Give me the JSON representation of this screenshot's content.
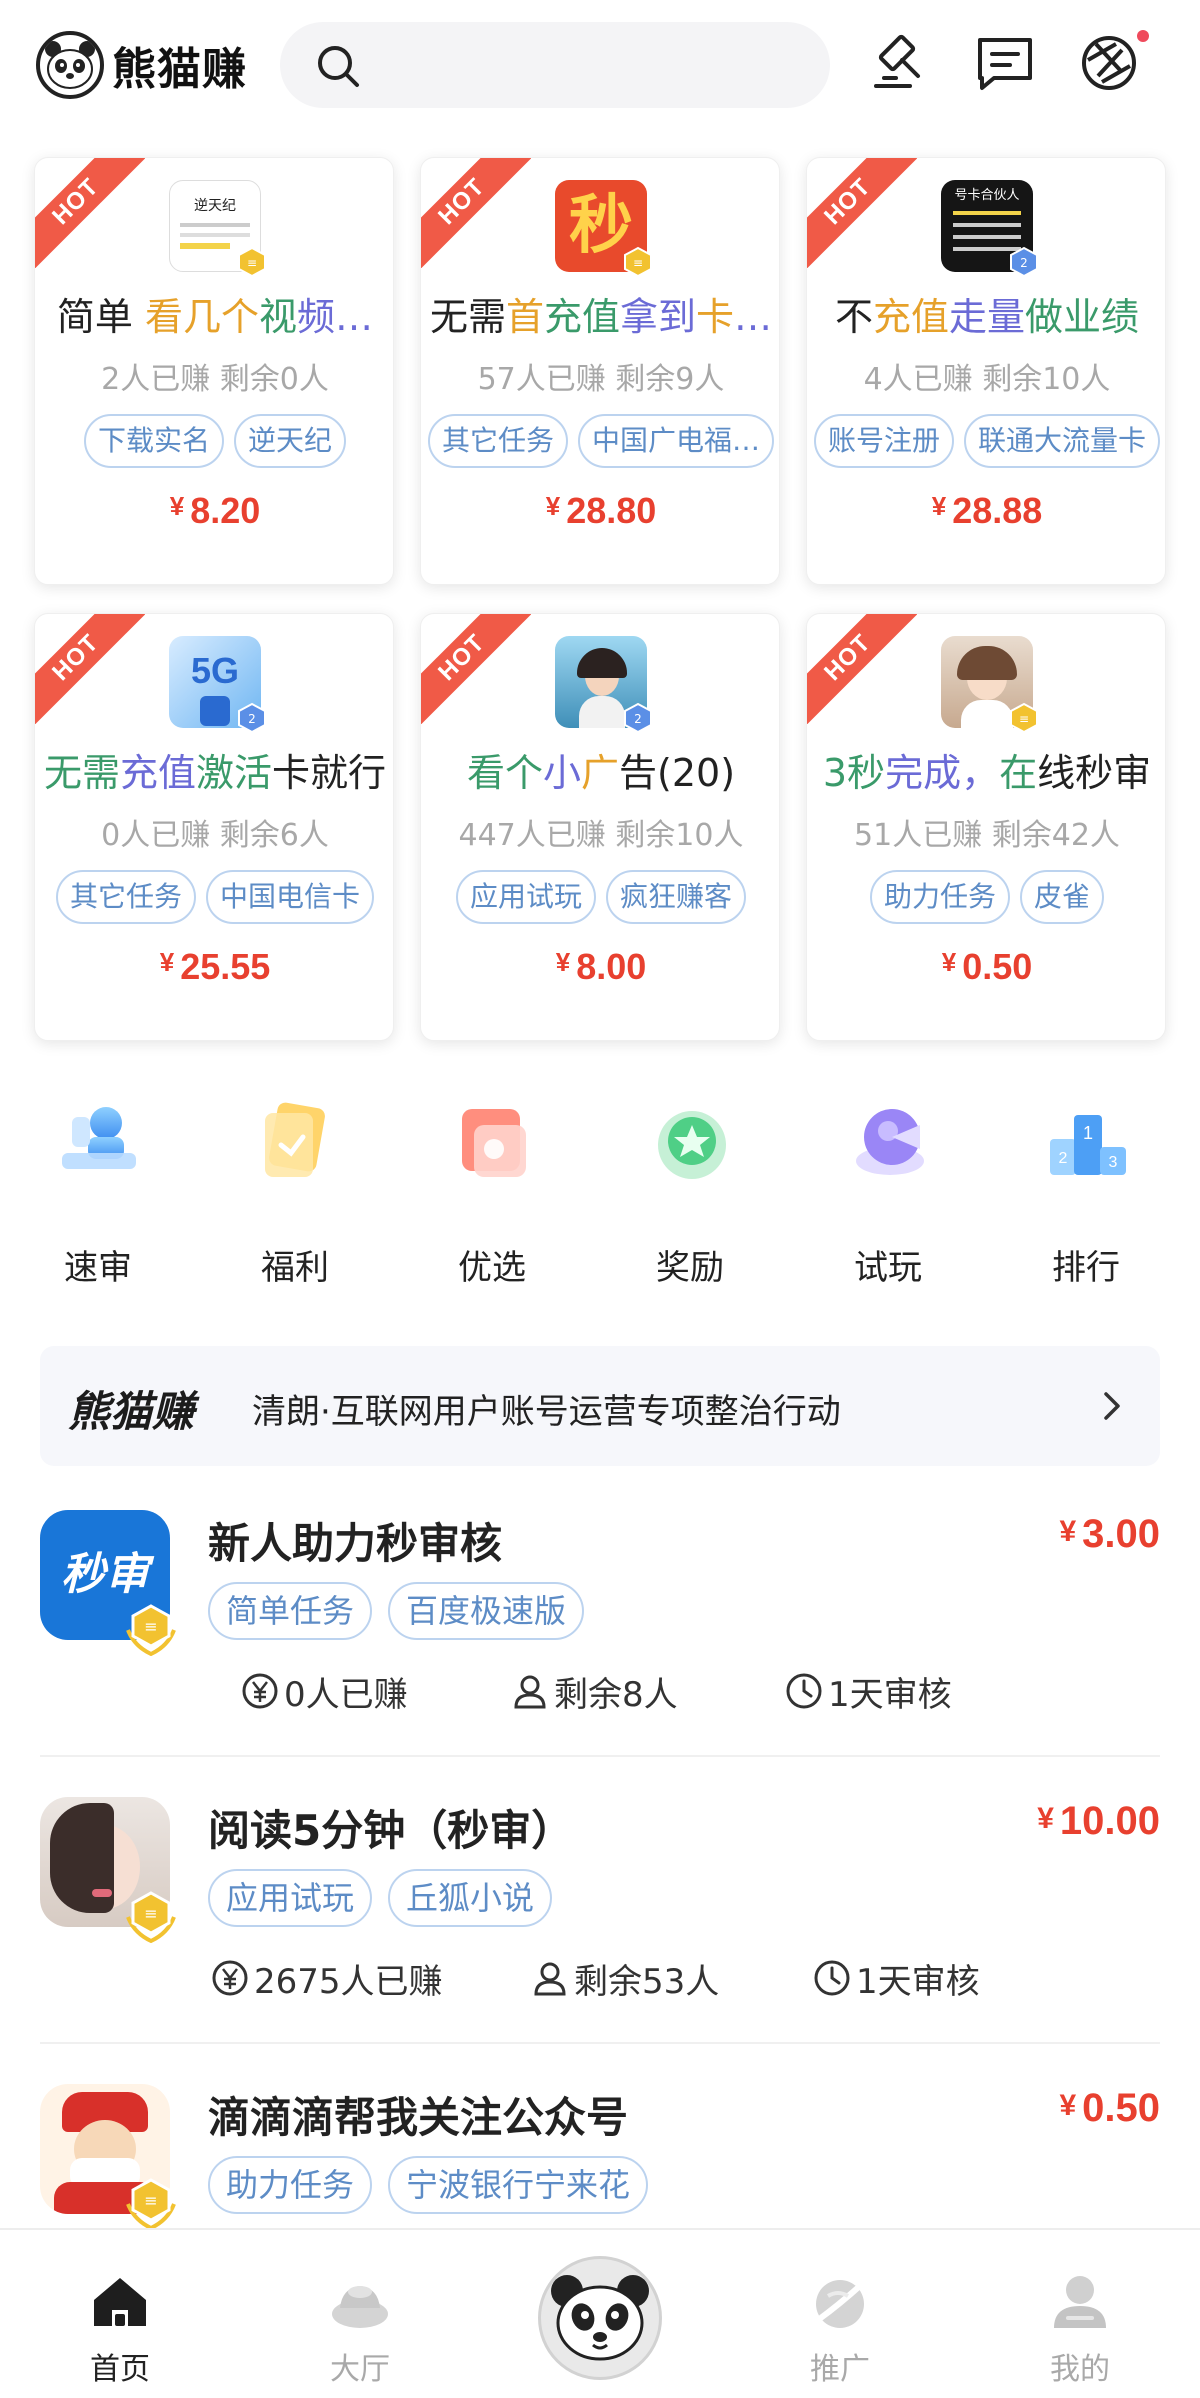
{
  "header": {
    "logo_text": "熊猫赚",
    "search_placeholder": ""
  },
  "hot_label": "HOT",
  "hot_cards": [
    {
      "title": "简单 看几个视频…",
      "stats": "2人已赚  剩余0人",
      "tags": [
        "下载实名",
        "逆天纪"
      ],
      "price": "8.20",
      "thumb_text": "逆天纪"
    },
    {
      "title": "无需首充值拿到卡…",
      "stats": "57人已赚  剩余9人",
      "tags": [
        "其它任务",
        "中国广电福…"
      ],
      "price": "28.80",
      "thumb_text": "秒"
    },
    {
      "title": "不充值走量做业绩",
      "stats": "4人已赚  剩余10人",
      "tags": [
        "账号注册",
        "联通大流量卡"
      ],
      "price": "28.88",
      "thumb_text": "号卡合伙人"
    },
    {
      "title": "无需充值激活卡就行",
      "stats": "0人已赚  剩余6人",
      "tags": [
        "其它任务",
        "中国电信卡"
      ],
      "price": "25.55",
      "thumb_text": "5G"
    },
    {
      "title": "看个小广告(20)",
      "stats": "447人已赚  剩余10人",
      "tags": [
        "应用试玩",
        "疯狂赚客"
      ],
      "price": "8.00",
      "thumb_text": ""
    },
    {
      "title": "3秒完成，在线秒审",
      "stats": "51人已赚  剩余42人",
      "tags": [
        "助力任务",
        "皮雀"
      ],
      "price": "0.50",
      "thumb_text": ""
    }
  ],
  "currency": "¥",
  "categories": [
    {
      "label": "速审",
      "icon": "fast-review-icon"
    },
    {
      "label": "福利",
      "icon": "welfare-icon"
    },
    {
      "label": "优选",
      "icon": "preferred-icon"
    },
    {
      "label": "奖励",
      "icon": "reward-icon"
    },
    {
      "label": "试玩",
      "icon": "trial-play-icon"
    },
    {
      "label": "排行",
      "icon": "ranking-icon"
    }
  ],
  "notice": {
    "logo": "熊猫赚",
    "text": "清朗·互联网用户账号运营专项整治行动"
  },
  "tasks": [
    {
      "title": "新人助力秒审核",
      "price": "3.00",
      "tags": [
        "简单任务",
        "百度极速版"
      ],
      "earned": "0人已赚",
      "remaining": "剩余8人",
      "review": "1天审核",
      "avatar_text": "秒审"
    },
    {
      "title": "阅读5分钟（秒审）",
      "price": "10.00",
      "tags": [
        "应用试玩",
        "丘狐小说"
      ],
      "earned": "2675人已赚",
      "remaining": "剩余53人",
      "review": "1天审核",
      "avatar_text": ""
    },
    {
      "title": "滴滴滴帮我关注公众号",
      "price": "0.50",
      "tags": [
        "助力任务",
        "宁波银行宁来花"
      ],
      "earned": "",
      "remaining": "",
      "review": "",
      "avatar_text": ""
    }
  ],
  "tabbar": [
    {
      "label": "首页",
      "icon": "home-icon",
      "active": true
    },
    {
      "label": "大厅",
      "icon": "hall-icon",
      "active": false
    },
    {
      "label": "推广",
      "icon": "promote-icon",
      "active": false
    },
    {
      "label": "我的",
      "icon": "profile-icon",
      "active": false
    }
  ],
  "colors": {
    "accent_red": "#e8402f",
    "tag_blue": "#5d8cc6",
    "hot_ribbon": "#f05a47"
  }
}
